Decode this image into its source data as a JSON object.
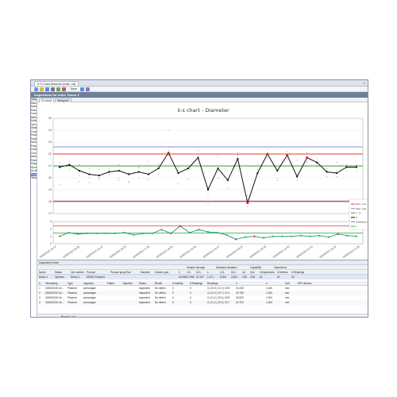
{
  "window": {
    "tab_label": "X̄-S Chart Diameter [Indiv. val]",
    "close_glyph": "×",
    "header": "Inspections for order 'Demo 1'"
  },
  "toolbar": {
    "save_label": "Save"
  },
  "sidebar": {
    "items": [
      "Characteristics",
      "Machining",
      "Assembly",
      "Finished",
      "Turning",
      "Milling",
      "Drilling",
      "Grinding",
      "Welding",
      "Coating",
      "Painted",
      "Sealed",
      "Hardened",
      "Polished",
      "Cleaned",
      "Checked",
      "Measured",
      "Packed",
      "Shipped",
      "Stored",
      "Archived",
      "Inspected",
      "Tested"
    ]
  },
  "chart_tabs": [
    "X̄-s chart",
    "Histogram"
  ],
  "chart_data": {
    "type": "line",
    "title": "x̄-s chart - Diameter",
    "top": {
      "ylim": [
        17,
        25
      ],
      "yticks": [
        17,
        18,
        19,
        20,
        21,
        22,
        23,
        24,
        25
      ],
      "ucl": 22.0,
      "lcl": 18.05,
      "usl": 22.6,
      "lsl": 18.0,
      "target": 21.0,
      "means": [
        20.9,
        21.1,
        20.6,
        20.3,
        20.2,
        20.5,
        20.6,
        20.3,
        20.5,
        20.3,
        20.8,
        22.1,
        20.4,
        20.8,
        21.7,
        19.0,
        20.8,
        19.8,
        21.6,
        17.9,
        20.4,
        22.0,
        20.6,
        21.9,
        20.1,
        21.7,
        21.3,
        20.5,
        20.4,
        20.9,
        20.9
      ],
      "out_of_control": [
        11,
        19,
        21,
        23,
        25
      ],
      "indiv": [
        [
          19.4,
          20.9,
          21.3
        ],
        [
          20.7,
          21.4,
          21.0
        ],
        [
          20.2,
          21.1,
          19.7
        ],
        [
          20.0,
          19.6,
          20.8
        ],
        [
          19.9,
          20.7,
          20.0
        ],
        [
          20.8,
          20.3,
          20.6
        ],
        [
          21.1,
          20.0,
          19.8
        ],
        [
          20.4,
          19.6,
          19.7
        ],
        [
          20.0,
          20.8,
          20.9
        ],
        [
          19.9,
          20.5,
          21.4
        ],
        [
          20.3,
          21.2,
          21.1
        ],
        [
          21.9,
          22.3,
          24.0
        ],
        [
          19.5,
          20.6,
          20.9
        ],
        [
          20.8,
          20.6,
          19.9
        ],
        [
          21.5,
          22.3,
          21.2
        ],
        [
          18.6,
          19.2,
          17.8
        ],
        [
          21.8,
          20.6,
          20.0
        ],
        [
          19.1,
          20.2,
          20.6
        ],
        [
          21.6,
          21.9,
          22.1
        ],
        [
          17.6,
          18.5,
          18.2
        ],
        [
          20.3,
          20.7,
          21.2
        ],
        [
          21.6,
          22.4,
          21.9
        ],
        [
          20.0,
          21.0,
          19.8
        ],
        [
          21.6,
          22.2,
          21.9
        ],
        [
          19.8,
          20.3,
          21.5
        ],
        [
          21.4,
          22.1,
          21.3
        ],
        [
          21.2,
          21.6,
          20.9
        ],
        [
          20.6,
          20.1,
          20.8
        ],
        [
          20.1,
          20.6,
          21.3
        ],
        [
          20.6,
          21.1,
          20.9
        ],
        [
          20.9,
          20.5,
          21.1
        ]
      ]
    },
    "bottom": {
      "ylim": [
        0,
        3
      ],
      "yticks": [
        0,
        1,
        2,
        3
      ],
      "ucl": 2.4,
      "center": 1.45,
      "values": [
        1.0,
        1.5,
        1.3,
        1.4,
        1.4,
        1.4,
        1.4,
        1.5,
        1.2,
        1.4,
        1.4,
        1.9,
        1.4,
        2.4,
        1.5,
        1.9,
        1.6,
        1.5,
        1.2,
        0.6,
        0.9,
        1.0,
        0.8,
        1.0,
        1.0,
        1.0,
        1.1,
        1.0,
        1.1,
        0.9,
        1.3,
        1.1,
        1.0
      ],
      "out_of_control": [
        12,
        13,
        19,
        21,
        30
      ]
    },
    "xticks": [
      "20/06/2015 14:14",
      "20/06/2015 16:06",
      "20/06/2015 16:13",
      "20/06/2015 16:29",
      "20/06/2015 17:45",
      "20/06/2015 19:45",
      "20/06/2015 19:53",
      "20/06/2015 20:07",
      "20/06/2015 20:25",
      "20/06/2015 20:30",
      "20/06/2015 21:40",
      "20/06/2015 21:51",
      "20/06/2015 16:23",
      "20/06/2015 17:28"
    ],
    "legend": [
      "UCL / LCL",
      "USL / LSL",
      "T / X̄",
      "X̄",
      "Individual values",
      "s"
    ]
  },
  "colors": {
    "mean_line": "#111111",
    "s_line": "#1a9a7a",
    "ucl": "#e23a3a",
    "usl": "#8a8ae0",
    "target": "#2aa02a",
    "out": "#e02020",
    "point_green": "#2bb04a"
  },
  "grid": {
    "title": "Inspection Order",
    "groups": [
      "Sample average",
      "Standard deviation",
      "Capability",
      "Inspections"
    ],
    "order_headers": [
      "Name",
      "Status",
      "Job number",
      "Product",
      "Product group",
      "Tool",
      "Machine",
      "Custom part",
      "x̄",
      "LCL",
      "UCL",
      "s",
      "LCL",
      "UCL",
      "Cp",
      "Cpk",
      "# Inspections",
      "# Defects",
      "# Readings"
    ],
    "order_row": [
      "Demo 1",
      "Opened",
      "Demo 1",
      "DEMO Product1",
      "",
      "",
      "",
      "",
      "20.088",
      "17.966",
      "22.107",
      "1.471",
      "0.000",
      "3.091",
      "0.52",
      "0.50",
      "31",
      "31",
      "93"
    ],
    "insp_headers": [
      "#",
      "Timestamp",
      "Type",
      "Inspector",
      "Failed",
      "Machine",
      "Status",
      "Result",
      "# Defects",
      "# Readings",
      "Readings",
      "x̄",
      "s",
      "Unit",
      "SPC Alarms"
    ],
    "insp_rows": [
      [
        "1",
        "20/06/2015 14:...",
        "Planned",
        "pvmanager",
        "",
        "",
        "Inspected",
        "No defect",
        "0",
        "0",
        "3 | 21.5 | 21.0 | 20.9",
        "21.000",
        "1,000",
        "mm",
        ""
      ],
      [
        "2",
        "20/06/2015 16:...",
        "Planned",
        "pvmanager",
        "",
        "",
        "Inspected",
        "No defect",
        "0",
        "0",
        "3 | 21.0 | 20.7 | 21.4",
        "20.780",
        "1,000",
        "mm",
        ""
      ],
      [
        "3",
        "20/06/2015 16:...",
        "Planned",
        "pvmanager",
        "",
        "",
        "Inspected",
        "No defect",
        "0",
        "0",
        "3 | 21.4 | 20.3 | 19.9",
        "20.500",
        "1,000",
        "mm",
        ""
      ],
      [
        "4",
        "20/06/2015 16:...",
        "Planned",
        "pvmanager",
        "",
        "",
        "Inspected",
        "No defect",
        "0",
        "0",
        "3 | 21.2 | 20.5 | 20.7",
        "20.700",
        "1,000",
        "mm",
        ""
      ]
    ],
    "footer": "Record 1 of 1"
  }
}
